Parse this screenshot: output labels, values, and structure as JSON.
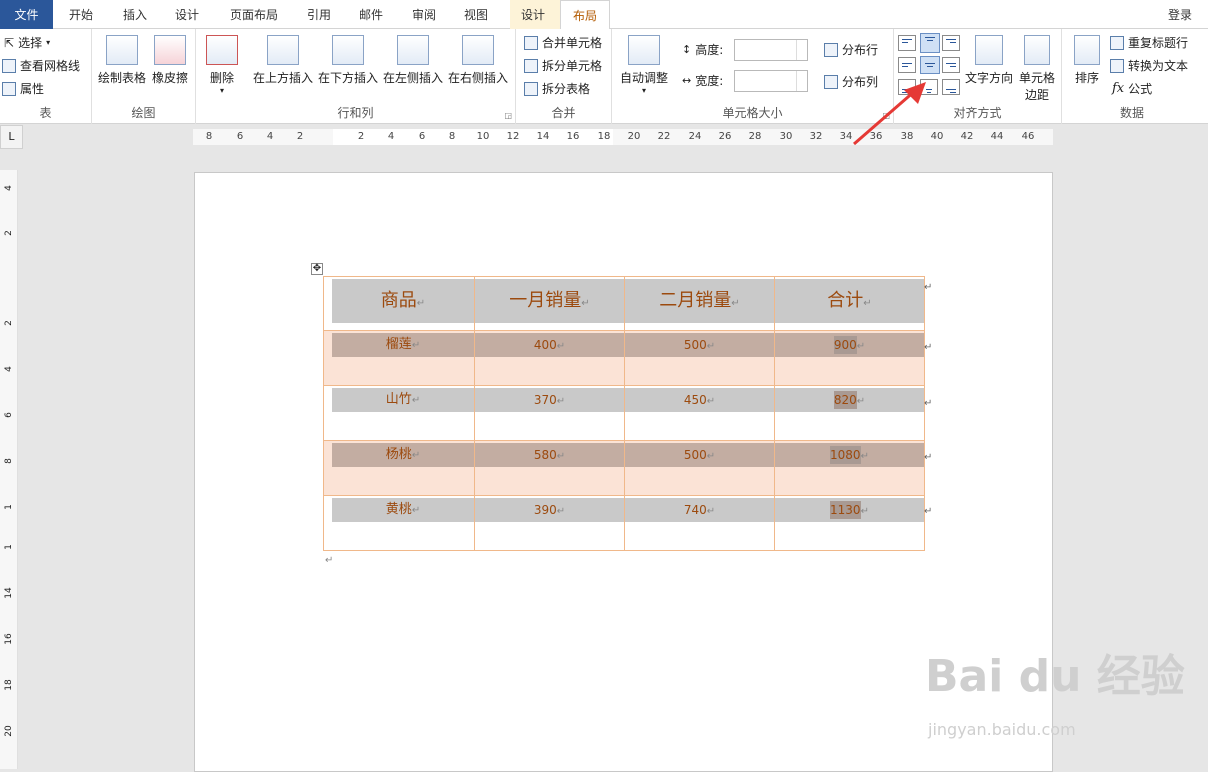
{
  "tabs": {
    "file": "文件",
    "home": "开始",
    "insert": "插入",
    "design": "设计",
    "page_layout": "页面布局",
    "references": "引用",
    "mailings": "邮件",
    "review": "审阅",
    "view": "视图",
    "table_design": "设计",
    "table_layout": "布局"
  },
  "login": "登录",
  "groups": {
    "table": {
      "label": "表",
      "select": "选择",
      "view_gridlines": "查看网格线",
      "properties": "属性"
    },
    "draw": {
      "label": "绘图",
      "draw_table": "绘制表格",
      "eraser": "橡皮擦"
    },
    "rows_cols": {
      "label": "行和列",
      "delete": "删除",
      "insert_above": "在上方插入",
      "insert_below": "在下方插入",
      "insert_left": "在左侧插入",
      "insert_right": "在右侧插入"
    },
    "merge": {
      "label": "合并",
      "merge_cells": "合并单元格",
      "split_cells": "拆分单元格",
      "split_table": "拆分表格"
    },
    "cell_size": {
      "label": "单元格大小",
      "autofit": "自动调整",
      "height": "高度:",
      "width": "宽度:",
      "distribute_rows": "分布行",
      "distribute_cols": "分布列"
    },
    "alignment": {
      "label": "对齐方式",
      "text_direction": "文字方向",
      "cell_margins_1": "单元格",
      "cell_margins_2": "边距"
    },
    "data": {
      "label": "数据",
      "sort": "排序",
      "repeat_header": "重复标题行",
      "convert_to_text": "转换为文本",
      "formula": "公式"
    }
  },
  "ruler": {
    "corner": "L",
    "h_numbers": [
      "8",
      "6",
      "4",
      "2",
      "2",
      "4",
      "6",
      "8",
      "10",
      "12",
      "14",
      "16",
      "18",
      "20",
      "22",
      "24",
      "26",
      "28",
      "30",
      "32",
      "34",
      "36",
      "38",
      "40",
      "42",
      "44",
      "46"
    ],
    "v_numbers": [
      "4",
      "2",
      "2",
      "4",
      "6",
      "8",
      "1",
      "1",
      "14",
      "16",
      "18",
      "20"
    ]
  },
  "table": {
    "headers": [
      "商品",
      "一月销量",
      "二月销量",
      "合计"
    ],
    "rows": [
      {
        "name": "榴莲",
        "jan": "400",
        "feb": "500",
        "total": "900"
      },
      {
        "name": "山竹",
        "jan": "370",
        "feb": "450",
        "total": "820"
      },
      {
        "name": "杨桃",
        "jan": "580",
        "feb": "500",
        "total": "1080"
      },
      {
        "name": "黄桃",
        "jan": "390",
        "feb": "740",
        "total": "1130"
      }
    ],
    "mark": "↵"
  },
  "watermark": {
    "main": "Bai du 经验",
    "sub": "jingyan.baidu.com"
  },
  "colors": {
    "accent": "#2b579a",
    "table_border": "#f0b88a",
    "text_brown": "#9c4a0e",
    "pink_row": "#fbe3d6",
    "arrow": "#e53935"
  }
}
